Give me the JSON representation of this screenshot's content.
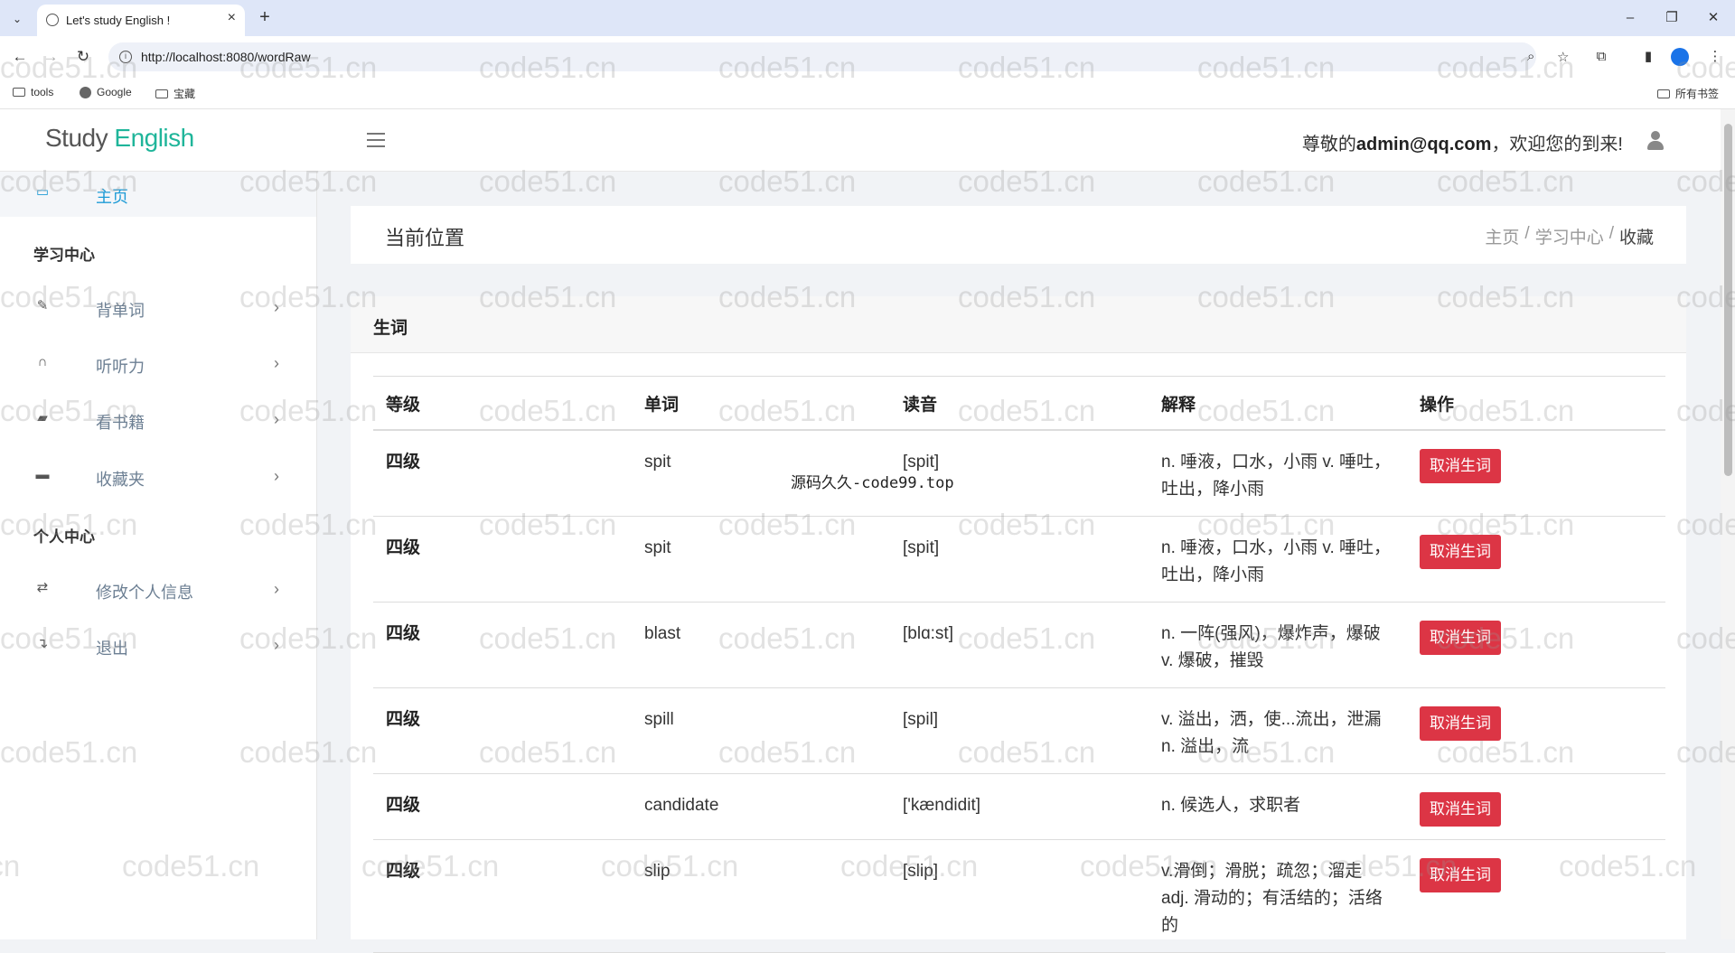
{
  "browser": {
    "tab_title": "Let's study English !",
    "url": "http://localhost:8080/wordRaw",
    "bookmarks": [
      "tools",
      "Google",
      "宝藏"
    ],
    "all_bookmarks": "所有书签"
  },
  "header": {
    "logo_word1": "Study",
    "logo_word2": "English",
    "welcome_prefix": "尊敬的",
    "user_email": "admin@qq.com",
    "welcome_suffix": "，欢迎您的到来!"
  },
  "sidebar": {
    "home": "主页",
    "section_study": "学习中心",
    "study_items": [
      "背单词",
      "听听力",
      "看书籍",
      "收藏夹"
    ],
    "section_personal": "个人中心",
    "personal_items": [
      "修改个人信息",
      "退出"
    ]
  },
  "breadcrumb": {
    "title": "当前位置",
    "trail": [
      "主页",
      "学习中心",
      "收藏"
    ]
  },
  "card": {
    "title": "生词",
    "columns": [
      "等级",
      "单词",
      "读音",
      "解释",
      "操作"
    ],
    "action_label": "取消生词",
    "rows": [
      {
        "level": "四级",
        "word": "spit",
        "phonetic": "[spit]",
        "meaning": "n. 唾液，口水，小雨 v. 唾吐，吐出，降小雨"
      },
      {
        "level": "四级",
        "word": "spit",
        "phonetic": "[spit]",
        "meaning": "n. 唾液，口水，小雨 v. 唾吐，吐出，降小雨"
      },
      {
        "level": "四级",
        "word": "blast",
        "phonetic": "[blɑ:st]",
        "meaning": "n. 一阵(强风)，爆炸声，爆破 v. 爆破，摧毁"
      },
      {
        "level": "四级",
        "word": "spill",
        "phonetic": "[spil]",
        "meaning": "v. 溢出，洒，使...流出，泄漏 n. 溢出，流"
      },
      {
        "level": "四级",
        "word": "candidate",
        "phonetic": "['kændidit]",
        "meaning": "n. 候选人，求职者"
      },
      {
        "level": "四级",
        "word": "slip",
        "phonetic": "[slip]",
        "meaning": "v.滑倒；滑脱；疏忽；溜走 adj. 滑动的；有活结的；活络的"
      }
    ]
  },
  "overlay_text": "源码久久-code99.top",
  "watermark": "code51.cn"
}
